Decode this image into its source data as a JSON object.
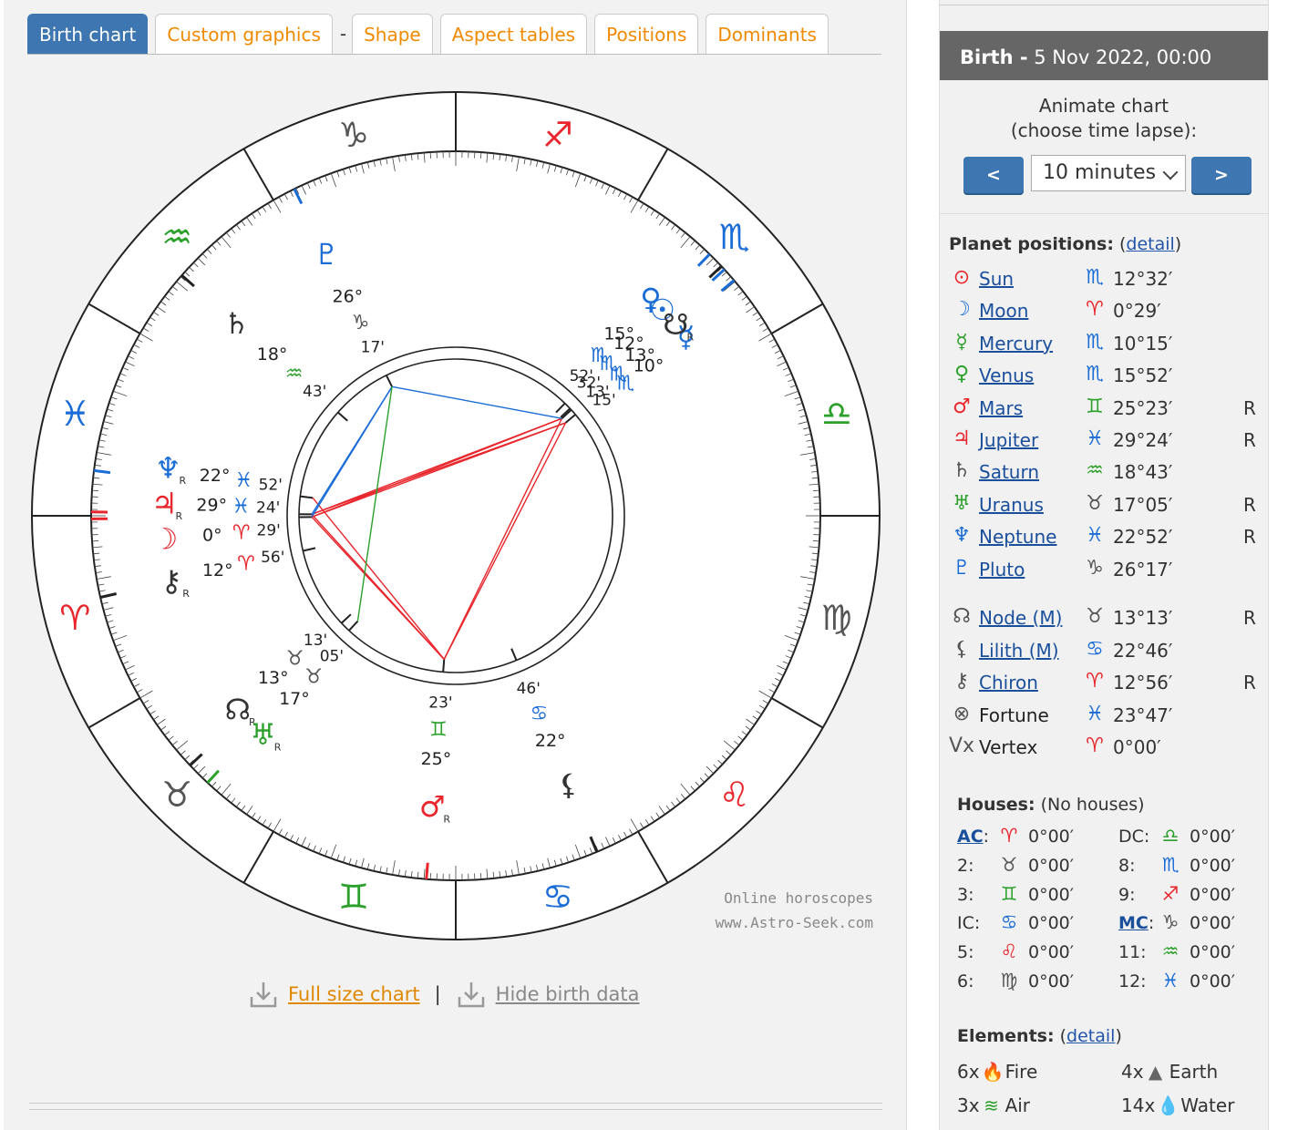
{
  "tabs": [
    {
      "label": "Birth chart",
      "active": true
    },
    {
      "label": "Custom graphics",
      "active": false
    },
    {
      "label": "Shape",
      "active": false
    },
    {
      "label": "Aspect tables",
      "active": false
    },
    {
      "label": "Positions",
      "active": false
    },
    {
      "label": "Dominants",
      "active": false
    }
  ],
  "tab_separator": "-",
  "watermark": {
    "line1": "Online horoscopes",
    "line2": "www.Astro-Seek.com"
  },
  "wheel_links": {
    "full_size": "Full size chart",
    "separator": "|",
    "hide": "Hide birth data"
  },
  "colors": {
    "fire": "#e8262c",
    "earth": "#555555",
    "air": "#2ba02b",
    "water": "#1a6cd6",
    "tab_active": "#3d76b0",
    "link_orange": "#f08a00"
  },
  "chart_data": {
    "type": "astrological wheel",
    "ascendant_sign": "aries",
    "zodiac_ring": [
      {
        "sign": "aries",
        "glyph": "♈",
        "element": "fire"
      },
      {
        "sign": "taurus",
        "glyph": "♉",
        "element": "earth"
      },
      {
        "sign": "gemini",
        "glyph": "♊",
        "element": "air"
      },
      {
        "sign": "cancer",
        "glyph": "♋",
        "element": "water"
      },
      {
        "sign": "leo",
        "glyph": "♌",
        "element": "fire"
      },
      {
        "sign": "virgo",
        "glyph": "♍",
        "element": "earth"
      },
      {
        "sign": "libra",
        "glyph": "♎",
        "element": "air"
      },
      {
        "sign": "scorpio",
        "glyph": "♏",
        "element": "water"
      },
      {
        "sign": "sagittarius",
        "glyph": "♐",
        "element": "fire"
      },
      {
        "sign": "capricorn",
        "glyph": "♑",
        "element": "earth"
      },
      {
        "sign": "aquarius",
        "glyph": "♒",
        "element": "air"
      },
      {
        "sign": "pisces",
        "glyph": "♓",
        "element": "water"
      }
    ],
    "points": [
      {
        "name": "Sun",
        "glyph": "☉",
        "lon": 222.53,
        "deg": "12°",
        "min": "32'",
        "sign_glyph": "♏",
        "element": "water",
        "retro": false
      },
      {
        "name": "Moon",
        "glyph": "☽",
        "lon": 0.48,
        "deg": "0°",
        "min": "29'",
        "sign_glyph": "♈",
        "element": "fire",
        "retro": false
      },
      {
        "name": "Mercury",
        "glyph": "☿",
        "lon": 220.25,
        "deg": "10°",
        "min": "15'",
        "sign_glyph": "♏",
        "element": "water",
        "retro": false
      },
      {
        "name": "Venus",
        "glyph": "♀",
        "lon": 225.87,
        "deg": "15°",
        "min": "52'",
        "sign_glyph": "♏",
        "element": "water",
        "retro": false
      },
      {
        "name": "Mars",
        "glyph": "♂",
        "lon": 85.38,
        "deg": "25°",
        "min": "23'",
        "sign_glyph": "♊",
        "element": "fire",
        "retro": true
      },
      {
        "name": "Jupiter",
        "glyph": "♃",
        "lon": 359.4,
        "deg": "29°",
        "min": "24'",
        "sign_glyph": "♓",
        "element": "fire",
        "retro": true
      },
      {
        "name": "Saturn",
        "glyph": "♄",
        "lon": 318.72,
        "deg": "18°",
        "min": "43'",
        "sign_glyph": "♒",
        "element": "earth",
        "retro": false
      },
      {
        "name": "Uranus",
        "glyph": "♅",
        "lon": 47.08,
        "deg": "17°",
        "min": "05'",
        "sign_glyph": "♉",
        "element": "air",
        "retro": true
      },
      {
        "name": "Neptune",
        "glyph": "♆",
        "lon": 352.87,
        "deg": "22°",
        "min": "52'",
        "sign_glyph": "♓",
        "element": "water",
        "retro": true
      },
      {
        "name": "Pluto",
        "glyph": "♇",
        "lon": 296.28,
        "deg": "26°",
        "min": "17'",
        "sign_glyph": "♑",
        "element": "water",
        "retro": false
      },
      {
        "name": "Node",
        "glyph": "☊",
        "lon": 43.22,
        "deg": "13°",
        "min": "13'",
        "sign_glyph": "♉",
        "element": "earth",
        "retro": true
      },
      {
        "name": "South Node",
        "glyph": "☋",
        "lon": 223.22,
        "deg": "13°",
        "min": "13'",
        "sign_glyph": "♏",
        "element": "earth",
        "retro": true
      },
      {
        "name": "Lilith",
        "glyph": "⚸",
        "lon": 112.77,
        "deg": "22°",
        "min": "46'",
        "sign_glyph": "♋",
        "element": "earth",
        "retro": false
      },
      {
        "name": "Chiron",
        "glyph": "⚷",
        "lon": 12.93,
        "deg": "12°",
        "min": "56'",
        "sign_glyph": "♈",
        "element": "earth",
        "retro": true
      }
    ],
    "aspects": [
      {
        "a": 222.53,
        "b": 0.48,
        "kind": "square"
      },
      {
        "a": 220.25,
        "b": 0.48,
        "kind": "square"
      },
      {
        "a": 222.53,
        "b": 359.4,
        "kind": "square"
      },
      {
        "a": 220.25,
        "b": 359.4,
        "kind": "square"
      },
      {
        "a": 222.53,
        "b": 85.38,
        "kind": "square"
      },
      {
        "a": 220.25,
        "b": 85.38,
        "kind": "square"
      },
      {
        "a": 359.4,
        "b": 85.38,
        "kind": "square"
      },
      {
        "a": 0.48,
        "b": 85.38,
        "kind": "square"
      },
      {
        "a": 352.87,
        "b": 85.38,
        "kind": "square"
      },
      {
        "a": 222.53,
        "b": 296.28,
        "kind": "sextile"
      },
      {
        "a": 296.28,
        "b": 359.4,
        "kind": "sextile"
      },
      {
        "a": 296.28,
        "b": 0.48,
        "kind": "sextile"
      },
      {
        "a": 296.28,
        "b": 47.08,
        "kind": "trine"
      }
    ]
  },
  "side": {
    "header_label": "Birth -",
    "header_date": "5 Nov 2022, 00:00",
    "animate_line1": "Animate chart",
    "animate_line2": "(choose time lapse):",
    "prev": "<",
    "next": ">",
    "lapse": "10 minutes",
    "planet_title": "Planet positions:",
    "detail_link": "detail",
    "planets": [
      {
        "glyph": "⊙",
        "gcolor": "#e8262c",
        "name": "Sun",
        "link": true,
        "sign": "♏",
        "scolor": "#1a6cd6",
        "deg": "12°32′",
        "retro": ""
      },
      {
        "glyph": "☽",
        "gcolor": "#1a6cd6",
        "name": "Moon",
        "link": true,
        "sign": "♈",
        "scolor": "#e8262c",
        "deg": "0°29′",
        "retro": ""
      },
      {
        "glyph": "☿",
        "gcolor": "#2ba02b",
        "name": "Mercury",
        "link": true,
        "sign": "♏",
        "scolor": "#1a6cd6",
        "deg": "10°15′",
        "retro": ""
      },
      {
        "glyph": "♀",
        "gcolor": "#2ba02b",
        "name": "Venus",
        "link": true,
        "sign": "♏",
        "scolor": "#1a6cd6",
        "deg": "15°52′",
        "retro": ""
      },
      {
        "glyph": "♂",
        "gcolor": "#e8262c",
        "name": "Mars",
        "link": true,
        "sign": "♊",
        "scolor": "#2ba02b",
        "deg": "25°23′",
        "retro": "R"
      },
      {
        "glyph": "♃",
        "gcolor": "#e8262c",
        "name": "Jupiter",
        "link": true,
        "sign": "♓",
        "scolor": "#1a6cd6",
        "deg": "29°24′",
        "retro": "R"
      },
      {
        "glyph": "♄",
        "gcolor": "#555555",
        "name": "Saturn",
        "link": true,
        "sign": "♒",
        "scolor": "#2ba02b",
        "deg": "18°43′",
        "retro": ""
      },
      {
        "glyph": "♅",
        "gcolor": "#2ba02b",
        "name": "Uranus",
        "link": true,
        "sign": "♉",
        "scolor": "#555555",
        "deg": "17°05′",
        "retro": "R"
      },
      {
        "glyph": "♆",
        "gcolor": "#1a6cd6",
        "name": "Neptune",
        "link": true,
        "sign": "♓",
        "scolor": "#1a6cd6",
        "deg": "22°52′",
        "retro": "R"
      },
      {
        "glyph": "♇",
        "gcolor": "#1a6cd6",
        "name": "Pluto",
        "link": true,
        "sign": "♑",
        "scolor": "#555555",
        "deg": "26°17′",
        "retro": ""
      }
    ],
    "points": [
      {
        "glyph": "☊",
        "gcolor": "#555555",
        "name": "Node (M)",
        "link": true,
        "sign": "♉",
        "scolor": "#555555",
        "deg": "13°13′",
        "retro": "R"
      },
      {
        "glyph": "⚸",
        "gcolor": "#555555",
        "name": "Lilith (M)",
        "link": true,
        "sign": "♋",
        "scolor": "#1a6cd6",
        "deg": "22°46′",
        "retro": ""
      },
      {
        "glyph": "⚷",
        "gcolor": "#555555",
        "name": "Chiron",
        "link": true,
        "sign": "♈",
        "scolor": "#e8262c",
        "deg": "12°56′",
        "retro": "R"
      },
      {
        "glyph": "⊗",
        "gcolor": "#555555",
        "name": "Fortune",
        "link": false,
        "sign": "♓",
        "scolor": "#1a6cd6",
        "deg": "23°47′",
        "retro": ""
      },
      {
        "glyph": "Vx",
        "gcolor": "#555555",
        "name": "Vertex",
        "link": false,
        "sign": "♈",
        "scolor": "#e8262c",
        "deg": "0°00′",
        "retro": ""
      }
    ],
    "houses_title": "Houses:",
    "houses_note": "(No houses)",
    "houses_left": [
      {
        "label": "AC",
        "link": true,
        "sign": "♈",
        "scolor": "#e8262c",
        "deg": "0°00′"
      },
      {
        "label": "2:",
        "link": false,
        "sign": "♉",
        "scolor": "#555555",
        "deg": "0°00′"
      },
      {
        "label": "3:",
        "link": false,
        "sign": "♊",
        "scolor": "#2ba02b",
        "deg": "0°00′"
      },
      {
        "label": "IC:",
        "link": false,
        "sign": "♋",
        "scolor": "#1a6cd6",
        "deg": "0°00′"
      },
      {
        "label": "5:",
        "link": false,
        "sign": "♌",
        "scolor": "#e8262c",
        "deg": "0°00′"
      },
      {
        "label": "6:",
        "link": false,
        "sign": "♍",
        "scolor": "#555555",
        "deg": "0°00′"
      }
    ],
    "houses_right": [
      {
        "label": "DC:",
        "link": false,
        "sign": "♎",
        "scolor": "#2ba02b",
        "deg": "0°00′"
      },
      {
        "label": "8:",
        "link": false,
        "sign": "♏",
        "scolor": "#1a6cd6",
        "deg": "0°00′"
      },
      {
        "label": "9:",
        "link": false,
        "sign": "♐",
        "scolor": "#e8262c",
        "deg": "0°00′"
      },
      {
        "label": "MC",
        "link": true,
        "sign": "♑",
        "scolor": "#555555",
        "deg": "0°00′"
      },
      {
        "label": "11:",
        "link": false,
        "sign": "♒",
        "scolor": "#2ba02b",
        "deg": "0°00′"
      },
      {
        "label": "12:",
        "link": false,
        "sign": "♓",
        "scolor": "#1a6cd6",
        "deg": "0°00′"
      }
    ],
    "elements_title": "Elements:",
    "elements_detail": "detail",
    "elements": [
      {
        "count": "6x",
        "icon": "fire-icon",
        "glyph": "🔥",
        "color": "#e8621c",
        "label": "Fire"
      },
      {
        "count": "4x",
        "icon": "earth-icon",
        "glyph": "▲",
        "color": "#666666",
        "label": "Earth"
      },
      {
        "count": "3x",
        "icon": "air-icon",
        "glyph": "≋",
        "color": "#2ba02b",
        "label": "Air"
      },
      {
        "count": "14x",
        "icon": "water-icon",
        "glyph": "💧",
        "color": "#1a8ad6",
        "label": "Water"
      }
    ]
  }
}
